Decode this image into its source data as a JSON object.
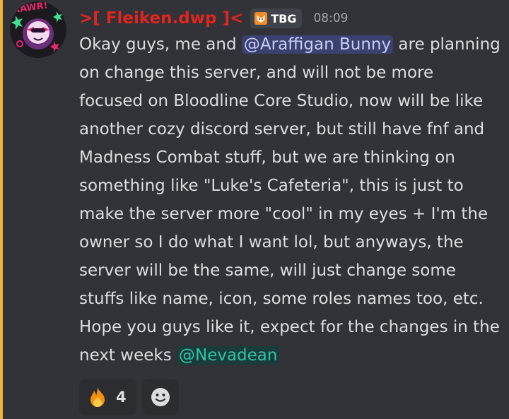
{
  "author": {
    "name": ">[ Fleiken.dwp ]<",
    "tag": "TBG",
    "timestamp": "08:09",
    "avatar_icon": "avatar-image",
    "avatar_text": "RAWR!",
    "color": "#e0261f"
  },
  "message": {
    "text_before_mention1": "Okay guys, me and ",
    "mention1": "@Araffigan Bunny",
    "text_middle": " are planning on change this server, and will not be more focused on Bloodline Core Studio, now will be like another cozy discord server, but still have fnf and Madness Combat stuff, but we are thinking on something like \"Luke's Cafeteria\", this is just to make the server more \"cool\" in my eyes + I'm the owner so I do what I want lol, but anyways, the server will be the same, will just change some stuffs like name, icon, some roles names too, etc. Hope you guys like it, expect for the changes in the next weeks ",
    "mention2": "@Nevadean"
  },
  "reactions": [
    {
      "emoji": "fire-icon",
      "count": "4"
    }
  ],
  "add_reaction_icon": "add-reaction-icon",
  "colors": {
    "background": "#313338",
    "highlight_bar": "#f0b232",
    "text": "#dbdee1",
    "user_mention_bg": "#3c4270",
    "role_mention_fg": "#2ec4a6"
  }
}
